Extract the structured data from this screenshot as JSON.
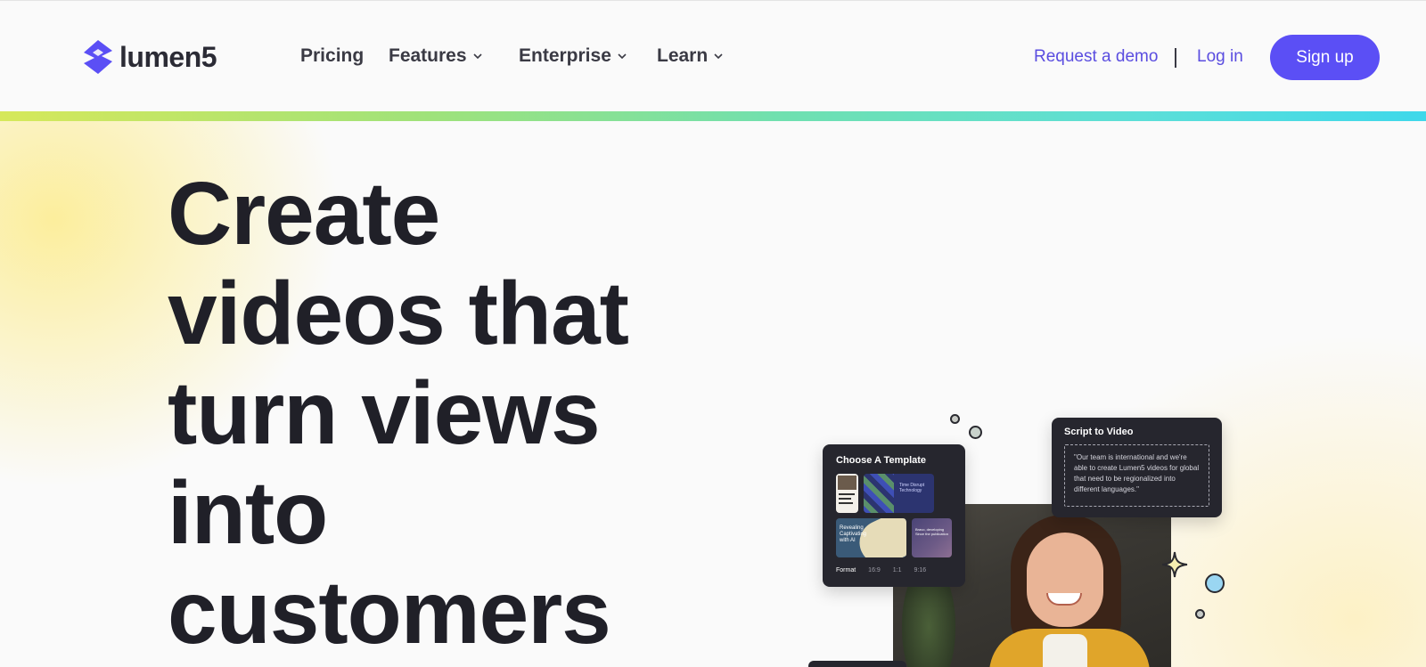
{
  "nav": {
    "logo_text": "lumen5",
    "links": [
      {
        "label": "Pricing",
        "has_dropdown": false
      },
      {
        "label": "Features",
        "has_dropdown": true
      },
      {
        "label": "Enterprise",
        "has_dropdown": true
      },
      {
        "label": "Learn",
        "has_dropdown": true
      }
    ],
    "request_demo": "Request a demo",
    "divider": "|",
    "login": "Log in",
    "signup": "Sign up"
  },
  "hero": {
    "headline_lines": [
      "Create",
      "videos that",
      "turn views",
      "into",
      "customers"
    ]
  },
  "illustration": {
    "template_card": {
      "title": "Choose A Template",
      "thumb2_text": "Time Disrupt Technology",
      "thumb3_text": "Revealing Captivating with AI",
      "thumb4_text": "Bravo, developing Since the publication",
      "format_label": "Format",
      "format_options": [
        "16:9",
        "1:1",
        "9:16"
      ]
    },
    "script_card": {
      "title": "Script to Video",
      "quote": "\"Our team is international and we're able to create Lumen5 videos for global that need to be regionalized into different languages.\""
    }
  },
  "colors": {
    "brand": "#5b4ff5",
    "link": "#5a4de0",
    "text": "#202028",
    "gradient_bar": [
      "#d6e85a",
      "#3fd8ea"
    ]
  },
  "icons": {
    "logo": "lumen5-logo-icon",
    "dropdown": "chevron-down-icon",
    "sparkle": "sparkle-icon"
  }
}
